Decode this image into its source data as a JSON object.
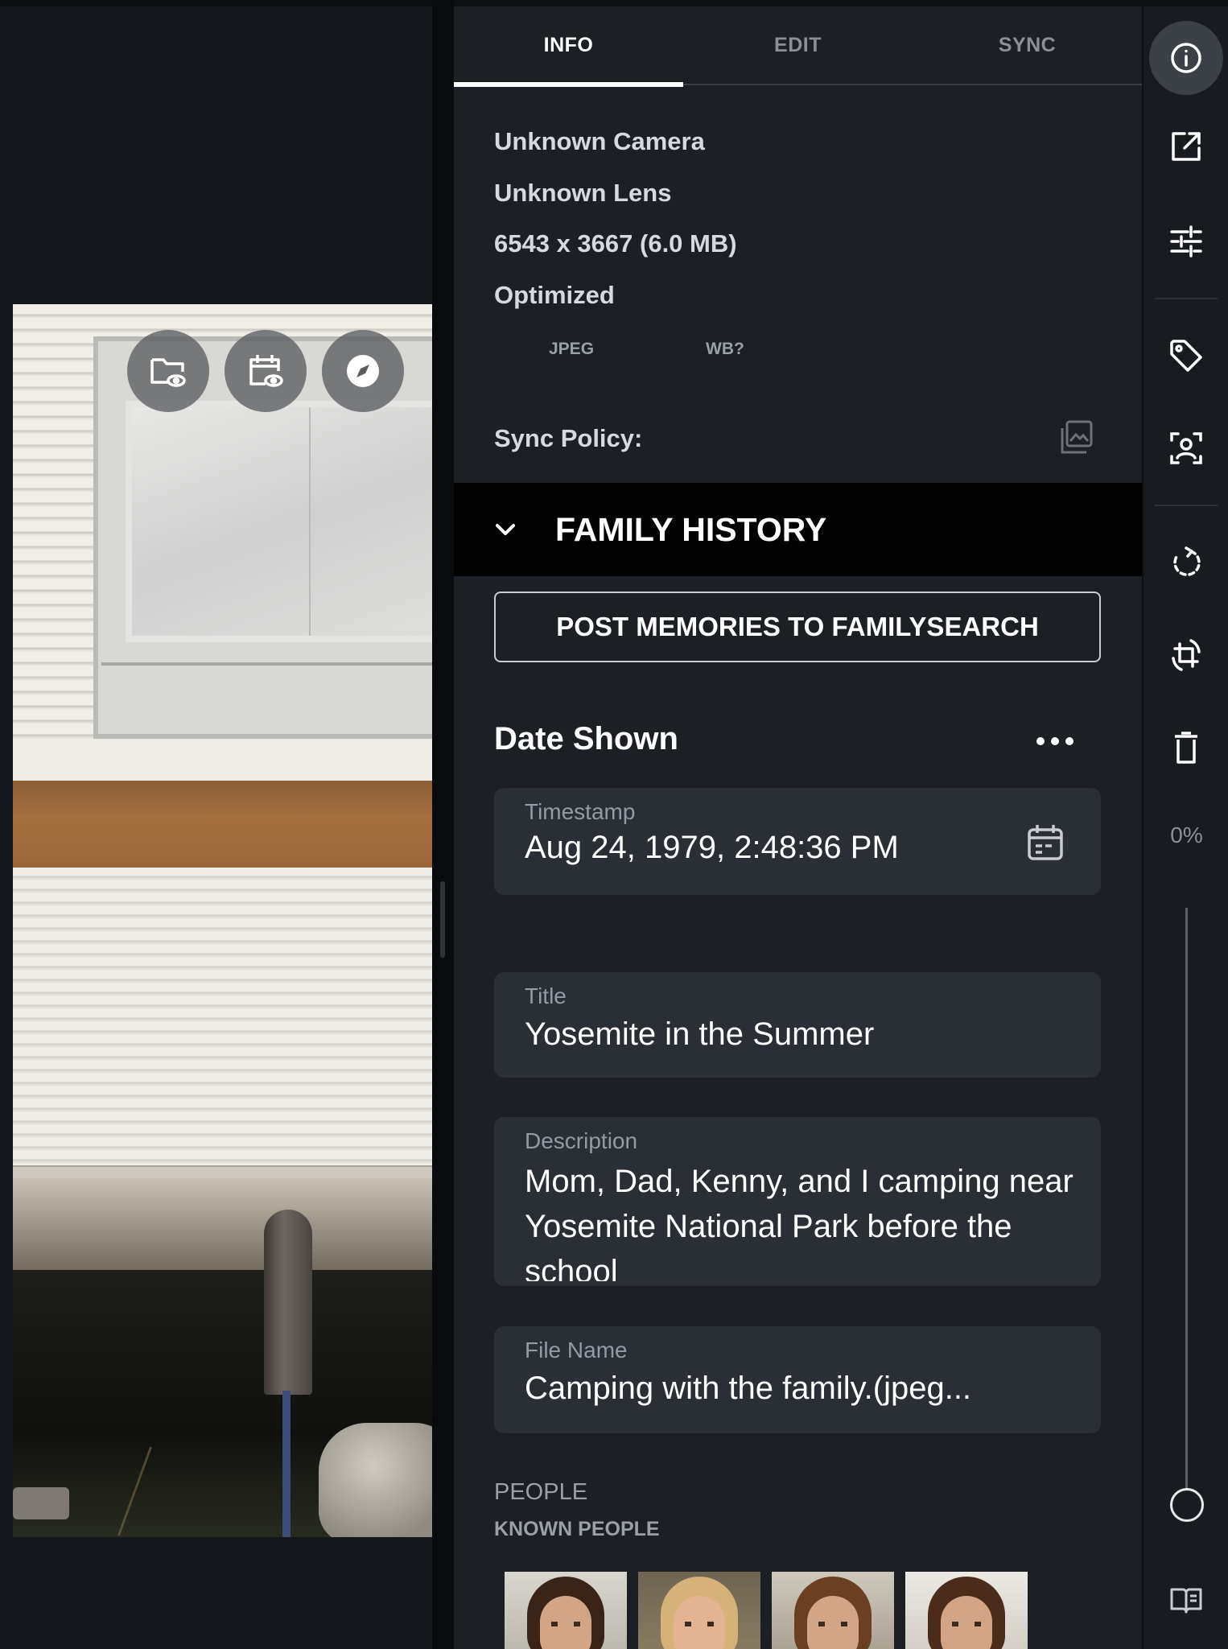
{
  "viewer": {
    "overlay_buttons": [
      {
        "icon": "folder-eye-icon"
      },
      {
        "icon": "calendar-eye-icon"
      },
      {
        "icon": "compass-icon"
      }
    ]
  },
  "tabs": [
    {
      "label": "INFO",
      "active": true
    },
    {
      "label": "EDIT",
      "active": false
    },
    {
      "label": "SYNC",
      "active": false
    }
  ],
  "info": {
    "camera": "Unknown Camera",
    "lens": "Unknown Lens",
    "dimensions": "6543 x 3667 (6.0 MB)",
    "status": "Optimized",
    "chips": [
      "JPEG",
      "WB?"
    ],
    "sync_policy_label": "Sync Policy:"
  },
  "section": {
    "title": "FAMILY HISTORY",
    "post_button": "POST MEMORIES TO FAMILYSEARCH",
    "date_heading": "Date Shown"
  },
  "fields": {
    "timestamp": {
      "label": "Timestamp",
      "value": "Aug 24, 1979, 2:48:36 PM"
    },
    "title": {
      "label": "Title",
      "value": "Yosemite in the Summer"
    },
    "description": {
      "label": "Description",
      "value": "Mom, Dad, Kenny, and I camping near Yosemite National Park before the school"
    },
    "file_name": {
      "label": "File Name",
      "value": "Camping with the family.(jpeg..."
    }
  },
  "people": {
    "label": "PEOPLE",
    "known_label": "KNOWN PEOPLE",
    "face_count": 4
  },
  "rail": {
    "buttons": [
      "info-icon",
      "open-external-icon",
      "adjustments-icon",
      "tag-icon",
      "face-scan-icon",
      "rotate-icon",
      "crop-rotate-icon",
      "trash-icon",
      "book-icon"
    ],
    "zoom_text": "0%",
    "zoom_fraction": 0
  },
  "colors": {
    "panel_bg": "#1c1f24",
    "field_bg": "#2a2e35",
    "section_bg": "#020203",
    "accent": "#ffffff"
  }
}
